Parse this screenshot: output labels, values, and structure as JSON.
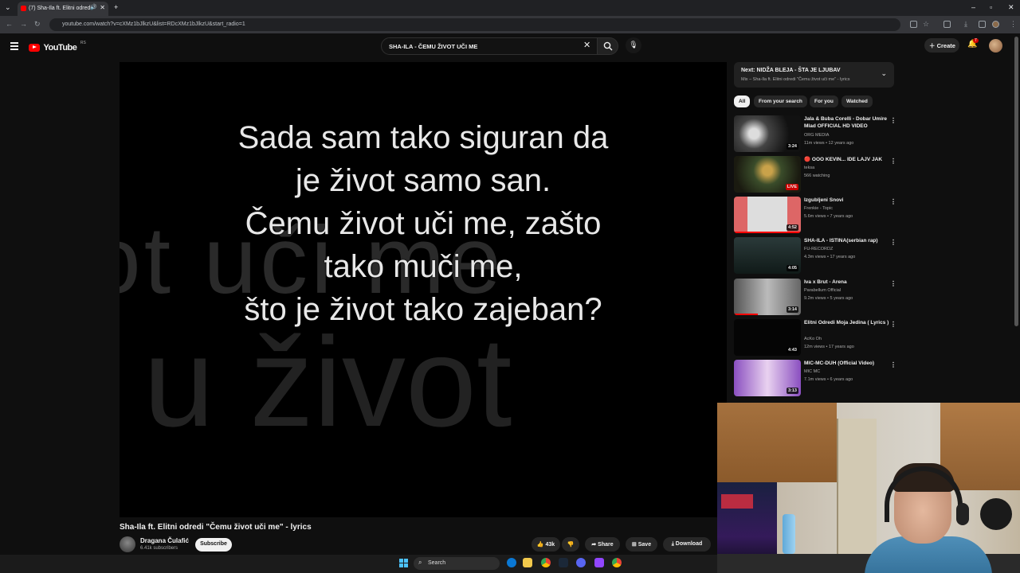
{
  "browser": {
    "tab_title": "(7) Sha-Ila ft. Elitni odredi \"",
    "url": "youtube.com/watch?v=cXMz1bJlkzU&list=RDcXMz1bJlkzU&start_radio=1"
  },
  "masthead": {
    "logo_text": "YouTube",
    "country_code": "RS",
    "search_value": "SHA-ILA - ČEMU ŽIVOT UČI ME",
    "create_label": "Create",
    "notification_count": "7"
  },
  "video": {
    "lyrics": [
      "Sada sam tako siguran da",
      "je život samo san.",
      "Čemu život uči me, zašto",
      "tako muči me,",
      "što je život tako zajeban?"
    ],
    "title": "Sha-Ila ft. Elitni odredi \"Čemu život uči me\" - lyrics",
    "channel": "Dragana Čulafić",
    "subscribers": "6.41k subscribers",
    "subscribe_label": "Subscribe",
    "likes": "43k",
    "share_label": "Share",
    "save_label": "Save",
    "download_label": "Download"
  },
  "up_next": {
    "title": "Next: NIDŽA BLEJA - ŠTA JE LJUBAV",
    "subtitle": "Mix – Sha-Ila ft. Elitni odredi \"Čemu život uči me\" - lyrics"
  },
  "chips": [
    "All",
    "From your search",
    "For you",
    "Watched"
  ],
  "recommendations": [
    {
      "title": "Jala & Buba Corelli - Dobar Umire Mlad OFFICIAL HD VIDEO",
      "channel": "ORG MEDIA",
      "meta": "11m views • 12 years ago",
      "badge": "3:24"
    },
    {
      "title": "🔴 OOO KEVIN... IDE LAJV JAK",
      "channel": "teksa",
      "meta": "566 watching",
      "badge": "LIVE"
    },
    {
      "title": "Izgubljeni Snovi",
      "channel": "Frenkie - Topic",
      "meta": "5.6m views • 7 years ago",
      "badge": "4:52"
    },
    {
      "title": "SHA-ILA - ISTINA(serbian rap)",
      "channel": "FU-RECORDZ",
      "meta": "4.3m views • 17 years ago",
      "badge": "4:05"
    },
    {
      "title": "Iva x Brut - Arena",
      "channel": "Parabellum Official",
      "meta": "9.2m views • 5 years ago",
      "badge": "3:14"
    },
    {
      "title": "Elitni Odredi Moja Jedina ( Lyrics )",
      "channel": "AcKo Oh",
      "meta": "12m views • 17 years ago",
      "badge": "4:43"
    },
    {
      "title": "MIC-MC-DUH (Official Video)",
      "channel": "MIC MC",
      "meta": "7.1m views • 6 years ago",
      "badge": "3:13"
    }
  ],
  "taskbar": {
    "search_placeholder": "Search"
  },
  "colors": {
    "yt_red": "#ff0000",
    "background": "#0f0f0f",
    "chip": "#272727"
  }
}
